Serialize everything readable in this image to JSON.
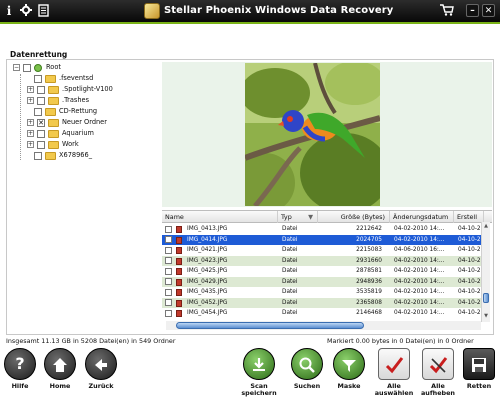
{
  "app": {
    "title": "Stellar Phoenix Windows Data Recovery"
  },
  "titlebar_icons": [
    "info-icon",
    "gear-icon",
    "document-icon",
    "cart-icon",
    "minimize-icon",
    "close-icon"
  ],
  "colors": {
    "titlebar": "#0d0d0d",
    "accent": "#7ab317",
    "row_even": "#dde9d3",
    "row_selected": "#1e5bd6"
  },
  "section_title": "Datenrettung",
  "tree": [
    {
      "label": "Root",
      "level": 0,
      "checked": false,
      "expanded": true
    },
    {
      "label": ".fseventsd",
      "level": 1,
      "checked": false
    },
    {
      "label": ".Spotlight-V100",
      "level": 1,
      "checked": false
    },
    {
      "label": ".Trashes",
      "level": 1,
      "checked": false
    },
    {
      "label": "CD-Rettung",
      "level": 1,
      "checked": false
    },
    {
      "label": "Neuer Ordner",
      "level": 1,
      "checked": true
    },
    {
      "label": "Aquarium",
      "level": 1,
      "checked": false
    },
    {
      "label": "Work",
      "level": 1,
      "checked": false
    },
    {
      "label": "X678966_",
      "level": 1,
      "checked": false
    }
  ],
  "table": {
    "columns": [
      "Name",
      "Typ",
      "Größe (Bytes)",
      "Änderungsdatum",
      "Erstell"
    ],
    "rows": [
      {
        "name": "IMG_0413.JPG",
        "type": "Datei",
        "size": "2212642",
        "modified": "04-02-2010 14:...",
        "created": "04-10-2",
        "selected": false
      },
      {
        "name": "IMG_0414.JPG",
        "type": "Datei",
        "size": "2024705",
        "modified": "04-02-2010 14:...",
        "created": "04-10-2",
        "selected": true
      },
      {
        "name": "IMG_0421.JPG",
        "type": "Datei",
        "size": "2215083",
        "modified": "04-06-2010 16:...",
        "created": "04-10-2",
        "selected": false
      },
      {
        "name": "IMG_0423.JPG",
        "type": "Datei",
        "size": "2931660",
        "modified": "04-02-2010 14:...",
        "created": "04-10-2",
        "selected": false
      },
      {
        "name": "IMG_0425.JPG",
        "type": "Datei",
        "size": "2878581",
        "modified": "04-02-2010 14:...",
        "created": "04-10-2",
        "selected": false
      },
      {
        "name": "IMG_0429.JPG",
        "type": "Datei",
        "size": "2948936",
        "modified": "04-02-2010 14:...",
        "created": "04-10-2",
        "selected": false
      },
      {
        "name": "IMG_0435.JPG",
        "type": "Datei",
        "size": "3535819",
        "modified": "04-02-2010 14:...",
        "created": "04-10-2",
        "selected": false
      },
      {
        "name": "IMG_0452.JPG",
        "type": "Datei",
        "size": "2365808",
        "modified": "04-02-2010 14:...",
        "created": "04-10-2",
        "selected": false
      },
      {
        "name": "IMG_0454.JPG",
        "type": "Datei",
        "size": "2146468",
        "modified": "04-02-2010 14:...",
        "created": "04-10-2",
        "selected": false
      }
    ]
  },
  "status": {
    "left": "Insgesamt 11.13 GB in 5208 Datei(en) in 549 Ordner",
    "right": "Markiert 0.00 bytes in 0 Datei(en) in 0 Ordner"
  },
  "toolbar": [
    {
      "label": "Hilfe",
      "icon": "help-icon"
    },
    {
      "label": "Home",
      "icon": "home-icon"
    },
    {
      "label": "Zurück",
      "icon": "back-icon"
    },
    {
      "label": "Scan speichern",
      "icon": "save-scan-icon"
    },
    {
      "label": "Suchen",
      "icon": "search-icon"
    },
    {
      "label": "Maske",
      "icon": "mask-icon"
    },
    {
      "label": "Alle auswählen",
      "icon": "select-all-icon"
    },
    {
      "label": "Alle aufheben",
      "icon": "deselect-all-icon"
    },
    {
      "label": "Retten",
      "icon": "recover-icon"
    }
  ]
}
